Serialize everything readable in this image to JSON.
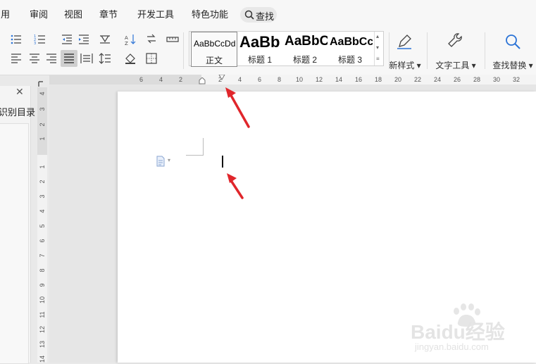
{
  "menubar": {
    "items": [
      "引用",
      "审阅",
      "视图",
      "章节",
      "开发工具",
      "特色功能"
    ],
    "search_label": "查找"
  },
  "toolbar": {
    "styles": [
      {
        "sample": "AaBbCcDd",
        "name": "正文"
      },
      {
        "sample": "AaBb",
        "name": "标题 1"
      },
      {
        "sample": "AaBbC",
        "name": "标题 2"
      },
      {
        "sample": "AaBbCc",
        "name": "标题 3"
      }
    ],
    "new_style_label": "新样式",
    "text_tools_label": "文字工具",
    "find_replace_label": "查找替换"
  },
  "ruler_h": {
    "ticks": [
      "6",
      "4",
      "2",
      "2",
      "4",
      "6",
      "8",
      "10",
      "12",
      "14",
      "16",
      "18",
      "20",
      "22",
      "24",
      "26",
      "28",
      "30",
      "32"
    ]
  },
  "ruler_v": {
    "ticks": [
      "4",
      "3",
      "2",
      "1",
      "1",
      "2",
      "3",
      "4",
      "5",
      "6",
      "7",
      "8",
      "9",
      "10",
      "11",
      "12",
      "13",
      "14"
    ]
  },
  "nav_pane": {
    "label": "识别目录"
  },
  "watermark": {
    "brand": "Baidu经验",
    "url": "jingyan.baidu.com"
  },
  "colors": {
    "accent": "#2b73d6",
    "arrow": "#e0262b"
  }
}
